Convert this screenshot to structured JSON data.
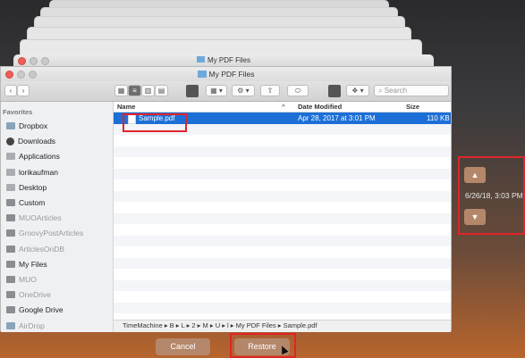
{
  "background_window": {
    "title": "My PDF Files"
  },
  "window": {
    "title": "My PDF Files",
    "search_placeholder": "Search"
  },
  "sidebar": {
    "section": "Favorites",
    "items": [
      {
        "label": "Dropbox",
        "icon": "dropbox-icon",
        "dim": false
      },
      {
        "label": "Downloads",
        "icon": "downloads-icon",
        "dim": false
      },
      {
        "label": "Applications",
        "icon": "applications-icon",
        "dim": false
      },
      {
        "label": "lorikaufman",
        "icon": "home-icon",
        "dim": false
      },
      {
        "label": "Desktop",
        "icon": "desktop-icon",
        "dim": false
      },
      {
        "label": "Custom",
        "icon": "folder-icon",
        "dim": false
      },
      {
        "label": "MUOArticles",
        "icon": "folder-icon",
        "dim": true
      },
      {
        "label": "GroovyPostArticles",
        "icon": "folder-icon",
        "dim": true
      },
      {
        "label": "ArticlesOnDB",
        "icon": "folder-icon",
        "dim": true
      },
      {
        "label": "My Files",
        "icon": "folder-icon",
        "dim": false
      },
      {
        "label": "MUO",
        "icon": "folder-icon",
        "dim": true
      },
      {
        "label": "OneDrive",
        "icon": "folder-icon",
        "dim": true
      },
      {
        "label": "Google Drive",
        "icon": "folder-icon",
        "dim": false
      },
      {
        "label": "AirDrop",
        "icon": "airdrop-icon",
        "dim": true
      }
    ]
  },
  "columns": {
    "name": "Name",
    "date": "Date Modified",
    "size": "Size"
  },
  "files": [
    {
      "name": "Sample.pdf",
      "date": "Apr 28, 2017 at 3:01 PM",
      "size": "110 KB"
    }
  ],
  "pathbar": "TimeMachine ▸ B ▸ L ▸ 2 ▸ M ▸ U ▸ l ▸ My PDF Files ▸ Sample.pdf",
  "timemachine": {
    "date": "6/26/18, 3:03 PM",
    "up_arrow": "▲",
    "down_arrow": "▼"
  },
  "buttons": {
    "cancel": "Cancel",
    "restore": "Restore"
  },
  "colors": {
    "selection": "#1c6fd6",
    "highlight": "#e0242a",
    "button": "#b5876a"
  }
}
